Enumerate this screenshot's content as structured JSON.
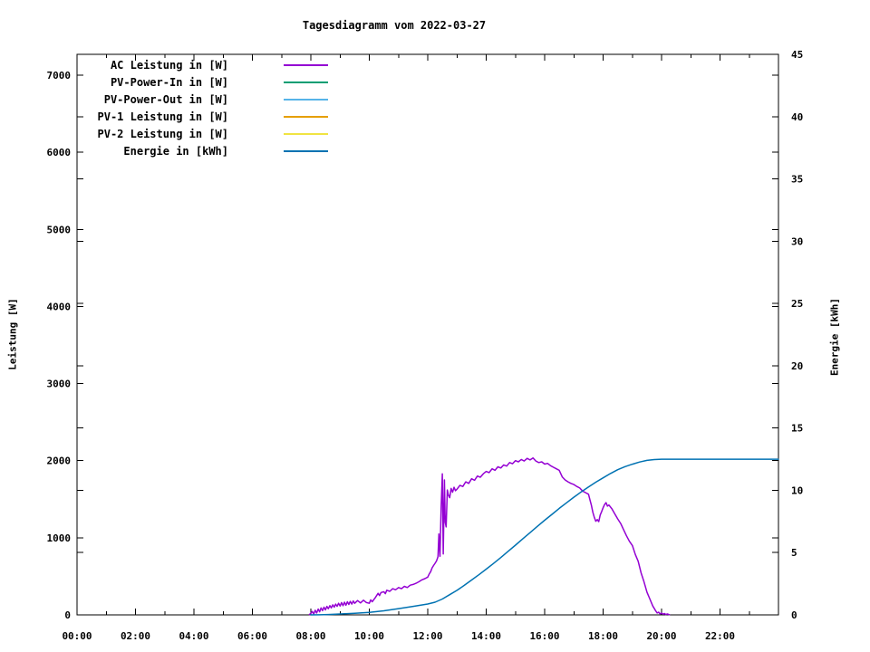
{
  "page": {
    "background": "#ffffff",
    "text_color": "#000000"
  },
  "chart_data": {
    "type": "line",
    "title": "Tagesdiagramm vom 2022-03-27",
    "grid": false,
    "legend_position": "top-left-inside",
    "x_axis": {
      "min_hour": 0,
      "max_hour": 24,
      "major_tick_hours": [
        0,
        2,
        4,
        6,
        8,
        10,
        12,
        14,
        16,
        18,
        20,
        22
      ],
      "minor_tick_hours": [
        1,
        3,
        5,
        7,
        9,
        11,
        13,
        15,
        17,
        19,
        21,
        23
      ],
      "tick_labels": [
        "00:00",
        "02:00",
        "04:00",
        "06:00",
        "08:00",
        "10:00",
        "12:00",
        "14:00",
        "16:00",
        "18:00",
        "20:00",
        "22:00"
      ]
    },
    "y1_axis": {
      "label": "Leistung [W]",
      "min": 0,
      "max": 7280,
      "tick_values": [
        0,
        1000,
        2000,
        3000,
        4000,
        5000,
        6000,
        7000
      ],
      "tick_labels": [
        "0",
        "1000",
        "2000",
        "3000",
        "4000",
        "5000",
        "6000",
        "7000"
      ]
    },
    "y2_axis": {
      "label": "Energie [kWh]",
      "min": 0,
      "max": 45,
      "tick_values": [
        0,
        5,
        10,
        15,
        20,
        25,
        30,
        35,
        40,
        45
      ],
      "tick_labels": [
        "0",
        "5",
        "10",
        "15",
        "20",
        "25",
        "30",
        "35",
        "40",
        "45"
      ]
    },
    "legend": [
      {
        "label": "AC Leistung in [W]",
        "color": "#9400d3"
      },
      {
        "label": "PV-Power-In in [W]",
        "color": "#009e73"
      },
      {
        "label": "PV-Power-Out in [W]",
        "color": "#56b4e9"
      },
      {
        "label": "PV-1 Leistung in [W]",
        "color": "#e69f00"
      },
      {
        "label": "PV-2 Leistung in [W]",
        "color": "#f0e442"
      },
      {
        "label": "Energie in [kWh]",
        "color": "#0072b2"
      }
    ],
    "series": [
      {
        "name": "AC Leistung in [W]",
        "axis": "y1",
        "color": "#9400d3",
        "points": [
          [
            7.95,
            5
          ],
          [
            8.0,
            20
          ],
          [
            8.05,
            45
          ],
          [
            8.1,
            10
          ],
          [
            8.15,
            60
          ],
          [
            8.2,
            25
          ],
          [
            8.25,
            75
          ],
          [
            8.3,
            40
          ],
          [
            8.35,
            90
          ],
          [
            8.4,
            55
          ],
          [
            8.45,
            100
          ],
          [
            8.5,
            65
          ],
          [
            8.55,
            110
          ],
          [
            8.6,
            80
          ],
          [
            8.65,
            120
          ],
          [
            8.7,
            90
          ],
          [
            8.75,
            130
          ],
          [
            8.8,
            100
          ],
          [
            8.85,
            140
          ],
          [
            8.9,
            110
          ],
          [
            8.95,
            150
          ],
          [
            9.0,
            115
          ],
          [
            9.05,
            160
          ],
          [
            9.1,
            120
          ],
          [
            9.15,
            165
          ],
          [
            9.2,
            125
          ],
          [
            9.25,
            170
          ],
          [
            9.3,
            135
          ],
          [
            9.35,
            175
          ],
          [
            9.4,
            140
          ],
          [
            9.45,
            180
          ],
          [
            9.5,
            150
          ],
          [
            9.6,
            185
          ],
          [
            9.7,
            155
          ],
          [
            9.8,
            190
          ],
          [
            9.9,
            160
          ],
          [
            10.0,
            150
          ],
          [
            10.05,
            195
          ],
          [
            10.1,
            170
          ],
          [
            10.2,
            220
          ],
          [
            10.3,
            280
          ],
          [
            10.35,
            250
          ],
          [
            10.4,
            290
          ],
          [
            10.5,
            300
          ],
          [
            10.55,
            275
          ],
          [
            10.6,
            320
          ],
          [
            10.7,
            305
          ],
          [
            10.8,
            340
          ],
          [
            10.9,
            325
          ],
          [
            11.0,
            355
          ],
          [
            11.1,
            340
          ],
          [
            11.2,
            370
          ],
          [
            11.3,
            355
          ],
          [
            11.4,
            385
          ],
          [
            11.5,
            395
          ],
          [
            11.6,
            410
          ],
          [
            11.7,
            430
          ],
          [
            11.8,
            455
          ],
          [
            11.9,
            470
          ],
          [
            12.0,
            490
          ],
          [
            12.05,
            530
          ],
          [
            12.1,
            560
          ],
          [
            12.15,
            610
          ],
          [
            12.2,
            640
          ],
          [
            12.25,
            670
          ],
          [
            12.3,
            700
          ],
          [
            12.35,
            755
          ],
          [
            12.38,
            1050
          ],
          [
            12.42,
            760
          ],
          [
            12.46,
            1400
          ],
          [
            12.5,
            1830
          ],
          [
            12.53,
            790
          ],
          [
            12.57,
            1750
          ],
          [
            12.6,
            1200
          ],
          [
            12.63,
            1140
          ],
          [
            12.67,
            1620
          ],
          [
            12.7,
            1560
          ],
          [
            12.75,
            1520
          ],
          [
            12.8,
            1640
          ],
          [
            12.85,
            1590
          ],
          [
            12.9,
            1655
          ],
          [
            12.95,
            1610
          ],
          [
            13.0,
            1630
          ],
          [
            13.1,
            1680
          ],
          [
            13.2,
            1665
          ],
          [
            13.3,
            1725
          ],
          [
            13.4,
            1705
          ],
          [
            13.5,
            1765
          ],
          [
            13.6,
            1745
          ],
          [
            13.7,
            1800
          ],
          [
            13.8,
            1785
          ],
          [
            13.9,
            1830
          ],
          [
            14.0,
            1860
          ],
          [
            14.1,
            1845
          ],
          [
            14.2,
            1895
          ],
          [
            14.3,
            1875
          ],
          [
            14.4,
            1920
          ],
          [
            14.5,
            1905
          ],
          [
            14.6,
            1945
          ],
          [
            14.7,
            1930
          ],
          [
            14.8,
            1975
          ],
          [
            14.9,
            1960
          ],
          [
            15.0,
            2000
          ],
          [
            15.1,
            1985
          ],
          [
            15.2,
            2015
          ],
          [
            15.3,
            1995
          ],
          [
            15.4,
            2030
          ],
          [
            15.5,
            2010
          ],
          [
            15.6,
            2035
          ],
          [
            15.7,
            1995
          ],
          [
            15.8,
            1975
          ],
          [
            15.9,
            1985
          ],
          [
            16.0,
            1955
          ],
          [
            16.1,
            1965
          ],
          [
            16.2,
            1935
          ],
          [
            16.3,
            1915
          ],
          [
            16.4,
            1895
          ],
          [
            16.5,
            1875
          ],
          [
            16.6,
            1790
          ],
          [
            16.7,
            1750
          ],
          [
            16.8,
            1725
          ],
          [
            16.9,
            1705
          ],
          [
            17.0,
            1690
          ],
          [
            17.1,
            1665
          ],
          [
            17.2,
            1645
          ],
          [
            17.3,
            1605
          ],
          [
            17.4,
            1585
          ],
          [
            17.5,
            1565
          ],
          [
            17.55,
            1490
          ],
          [
            17.6,
            1420
          ],
          [
            17.65,
            1330
          ],
          [
            17.7,
            1265
          ],
          [
            17.75,
            1215
          ],
          [
            17.8,
            1235
          ],
          [
            17.85,
            1210
          ],
          [
            17.9,
            1295
          ],
          [
            17.95,
            1340
          ],
          [
            18.0,
            1390
          ],
          [
            18.05,
            1430
          ],
          [
            18.1,
            1455
          ],
          [
            18.15,
            1410
          ],
          [
            18.2,
            1425
          ],
          [
            18.3,
            1375
          ],
          [
            18.4,
            1310
          ],
          [
            18.5,
            1245
          ],
          [
            18.6,
            1185
          ],
          [
            18.7,
            1105
          ],
          [
            18.8,
            1025
          ],
          [
            18.9,
            955
          ],
          [
            19.0,
            900
          ],
          [
            19.1,
            785
          ],
          [
            19.2,
            695
          ],
          [
            19.3,
            545
          ],
          [
            19.4,
            430
          ],
          [
            19.5,
            295
          ],
          [
            19.6,
            205
          ],
          [
            19.7,
            115
          ],
          [
            19.75,
            85
          ],
          [
            19.8,
            50
          ],
          [
            19.85,
            25
          ],
          [
            19.9,
            35
          ],
          [
            19.95,
            12
          ],
          [
            20.0,
            25
          ],
          [
            20.05,
            8
          ],
          [
            20.1,
            18
          ],
          [
            20.15,
            5
          ],
          [
            20.2,
            12
          ],
          [
            20.27,
            2
          ]
        ]
      },
      {
        "name": "Energie in [kWh]",
        "axis": "y2",
        "color": "#0072b2",
        "points": [
          [
            8.0,
            0
          ],
          [
            8.3,
            0.01
          ],
          [
            8.6,
            0.03
          ],
          [
            9.0,
            0.07
          ],
          [
            9.5,
            0.13
          ],
          [
            10.0,
            0.2
          ],
          [
            10.5,
            0.33
          ],
          [
            11.0,
            0.5
          ],
          [
            11.5,
            0.68
          ],
          [
            12.0,
            0.87
          ],
          [
            12.25,
            1.02
          ],
          [
            12.5,
            1.27
          ],
          [
            12.75,
            1.62
          ],
          [
            13.0,
            1.97
          ],
          [
            13.25,
            2.37
          ],
          [
            13.5,
            2.8
          ],
          [
            13.75,
            3.22
          ],
          [
            14.0,
            3.67
          ],
          [
            14.25,
            4.13
          ],
          [
            14.5,
            4.6
          ],
          [
            14.75,
            5.1
          ],
          [
            15.0,
            5.6
          ],
          [
            15.25,
            6.1
          ],
          [
            15.5,
            6.6
          ],
          [
            15.75,
            7.1
          ],
          [
            16.0,
            7.6
          ],
          [
            16.25,
            8.07
          ],
          [
            16.5,
            8.55
          ],
          [
            16.75,
            9.0
          ],
          [
            17.0,
            9.45
          ],
          [
            17.25,
            9.87
          ],
          [
            17.5,
            10.27
          ],
          [
            17.75,
            10.65
          ],
          [
            18.0,
            11.0
          ],
          [
            18.25,
            11.35
          ],
          [
            18.5,
            11.65
          ],
          [
            18.75,
            11.9
          ],
          [
            19.0,
            12.1
          ],
          [
            19.25,
            12.27
          ],
          [
            19.5,
            12.4
          ],
          [
            19.75,
            12.47
          ],
          [
            20.0,
            12.5
          ],
          [
            20.5,
            12.5
          ],
          [
            21.0,
            12.5
          ],
          [
            22.0,
            12.5
          ],
          [
            23.0,
            12.5
          ],
          [
            24.0,
            12.5
          ]
        ]
      }
    ]
  }
}
